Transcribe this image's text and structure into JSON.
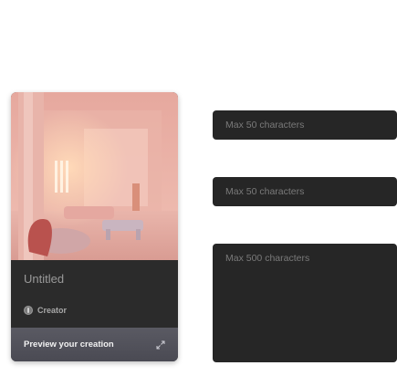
{
  "card": {
    "title": "Untitled",
    "creator": "Creator",
    "preview_label": "Preview your creation"
  },
  "fields": {
    "field1_placeholder": "Max 50 characters",
    "field2_placeholder": "Max 50 characters",
    "field3_placeholder": "Max 500 characters"
  },
  "icons": {
    "avatar": "creator-avatar-icon",
    "expand": "expand-icon"
  }
}
